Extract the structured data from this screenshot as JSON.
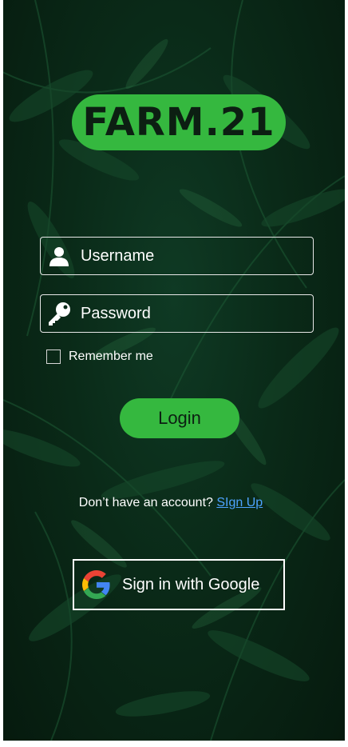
{
  "app": {
    "logo_text": "FARM.21"
  },
  "login_form": {
    "username": {
      "placeholder": "Username",
      "value": "",
      "icon": "user-icon"
    },
    "password": {
      "placeholder": "Password",
      "value": "",
      "icon": "key-icon"
    },
    "remember_label": "Remember me",
    "remember_checked": false,
    "login_label": "Login"
  },
  "signup": {
    "prompt": "Don’t have an account?",
    "link_label": "SIgn Up"
  },
  "google": {
    "label": "Sign in with Google",
    "icon": "google-icon"
  },
  "colors": {
    "accent": "#35b83f",
    "background": "#0a2a18",
    "link": "#4da3ff"
  }
}
